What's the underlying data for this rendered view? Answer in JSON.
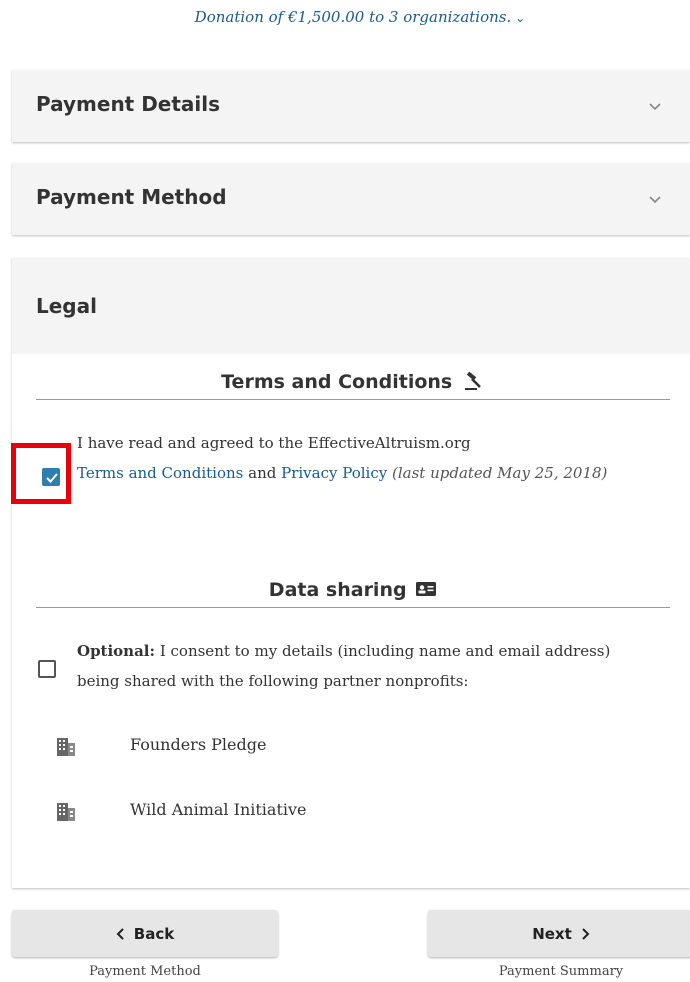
{
  "summary": {
    "text": "Donation of €1,500.00 to 3 organizations.",
    "chevron_icon": "chevron-down-icon"
  },
  "panels": {
    "payment_details": {
      "title": "Payment Details",
      "expanded": false
    },
    "payment_method": {
      "title": "Payment Method",
      "expanded": false
    },
    "legal": {
      "title": "Legal",
      "expanded": true
    }
  },
  "terms": {
    "heading": "Terms and Conditions",
    "heading_icon": "gavel-icon",
    "checked": true,
    "text_prefix": "I have read and agreed to the EffectiveAltruism.org",
    "link_terms": "Terms and Conditions",
    "and": "and",
    "link_privacy": "Privacy Policy",
    "last_updated": "(last updated May 25, 2018)"
  },
  "data_sharing": {
    "heading": "Data sharing",
    "heading_icon": "id-card-icon",
    "checked": false,
    "optional_label": "Optional:",
    "consent_text": "I consent to my details (including name and email address) being shared with the following partner nonprofits:",
    "organizations": [
      {
        "name": "Founders Pledge",
        "icon": "building-icon"
      },
      {
        "name": "Wild Animal Initiative",
        "icon": "building-icon"
      }
    ]
  },
  "navigation": {
    "back_label": "Back",
    "back_sub": "Payment Method",
    "next_label": "Next",
    "next_sub": "Payment Summary"
  },
  "colors": {
    "accent": "#2e7fad",
    "link": "#1a5b8a",
    "highlight": "#e8000a"
  }
}
